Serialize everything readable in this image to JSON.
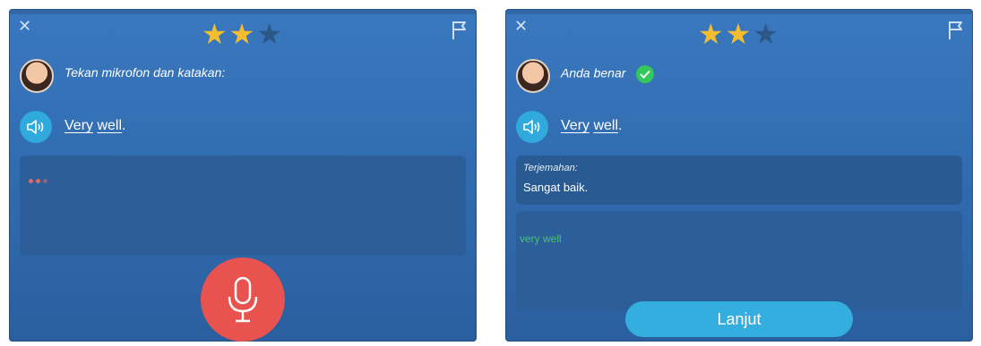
{
  "panels": [
    {
      "stars_total": 3,
      "stars_filled": 2,
      "prompt": "Tekan mikrofon dan katakan:",
      "phrase": {
        "word1": "Very",
        "word2": "well",
        "punct": "."
      }
    },
    {
      "stars_total": 3,
      "stars_filled": 2,
      "status": "Anda benar",
      "phrase": {
        "word1": "Very",
        "word2": "well",
        "punct": "."
      },
      "translation_label": "Terjemahan:",
      "translation": "Sangat baik.",
      "recognized": "very well",
      "continue_label": "Lanjut"
    }
  ],
  "icons": {
    "close": "close-icon",
    "flag": "flag-icon",
    "speaker": "speaker-icon",
    "mic": "microphone-icon",
    "check": "check-icon"
  },
  "colors": {
    "panel": "#2f69ac",
    "star_on": "#f4bd2f",
    "star_off": "#2b5888",
    "speaker": "#30a9dc",
    "mic": "#e8524f",
    "correct": "#34c759",
    "recognized": "#43c66b",
    "button": "#34aedf"
  }
}
